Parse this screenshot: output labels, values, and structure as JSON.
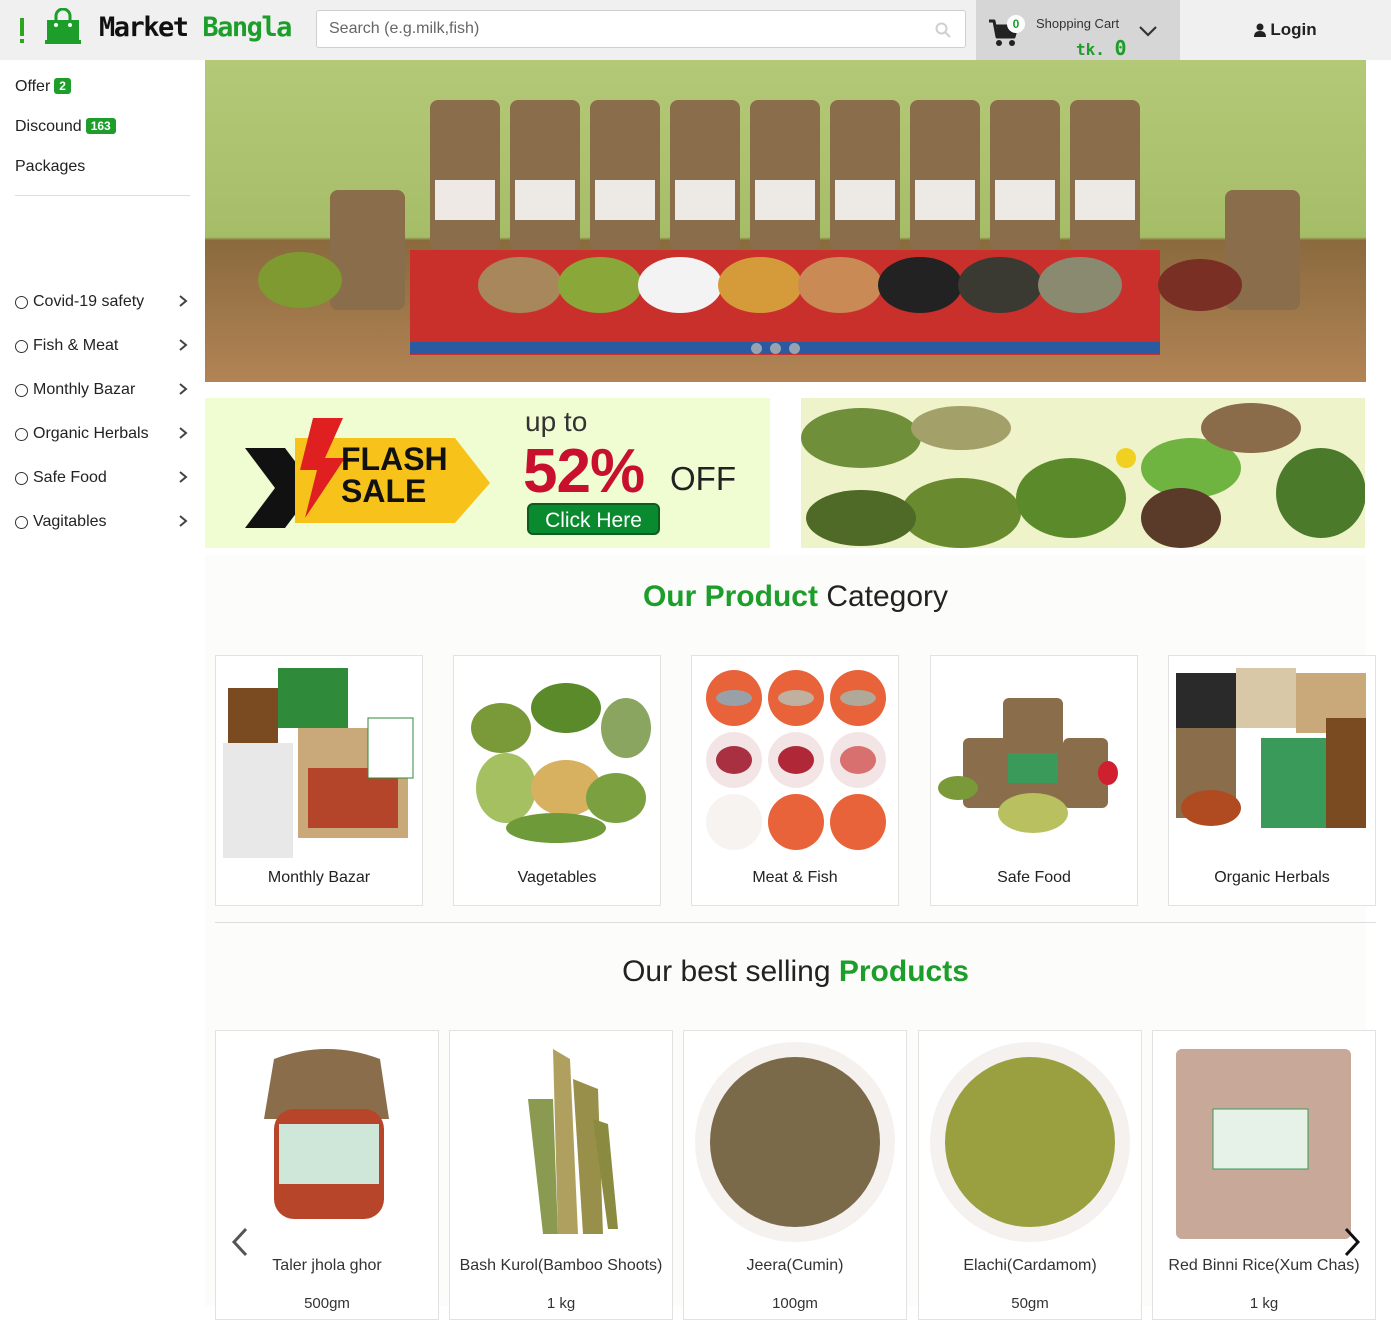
{
  "header": {
    "logo_part1": "Market",
    "logo_part2": "Bangla",
    "search_placeholder": "Search (e.g.milk,fish)",
    "cart_count": "0",
    "cart_label": "Shopping Cart",
    "cart_currency": "tk.",
    "cart_total": "0",
    "login_label": "Login"
  },
  "sidebar": {
    "top_links": [
      {
        "label": "Offer",
        "badge": "2"
      },
      {
        "label": "Discound",
        "badge": "163"
      },
      {
        "label": "Packages"
      }
    ],
    "categories": [
      {
        "label": "Covid-19 safety"
      },
      {
        "label": "Fish & Meat"
      },
      {
        "label": "Monthly Bazar"
      },
      {
        "label": "Organic Herbals"
      },
      {
        "label": "Safe Food"
      },
      {
        "label": "Vagitables"
      }
    ]
  },
  "promo": {
    "flash_line1": "FLASH",
    "flash_line2": "SALE",
    "upto": "up to",
    "percent": "52%",
    "off": "OFF",
    "cta": "Click Here"
  },
  "category_section": {
    "title_green1": "Our",
    "title_green2": "Product",
    "title_rest": "Category",
    "items": [
      {
        "label": "Monthly Bazar"
      },
      {
        "label": "Vagetables"
      },
      {
        "label": "Meat & Fish"
      },
      {
        "label": "Safe Food"
      },
      {
        "label": "Organic Herbals"
      }
    ]
  },
  "best_selling": {
    "title_part1": "Our best selling",
    "title_green": "Products",
    "products": [
      {
        "name": "Taler jhola ghor",
        "size": "500gm"
      },
      {
        "name": "Bash Kurol(Bamboo Shoots)",
        "size": "1 kg"
      },
      {
        "name": "Jeera(Cumin)",
        "size": "100gm"
      },
      {
        "name": "Elachi(Cardamom)",
        "size": "50gm"
      },
      {
        "name": "Red Binni Rice(Xum Chas)",
        "size": "1 kg"
      }
    ]
  },
  "colors": {
    "brand_green": "#1d9e2b",
    "sale_red": "#c8102e",
    "header_bg": "#f0f0f0"
  }
}
